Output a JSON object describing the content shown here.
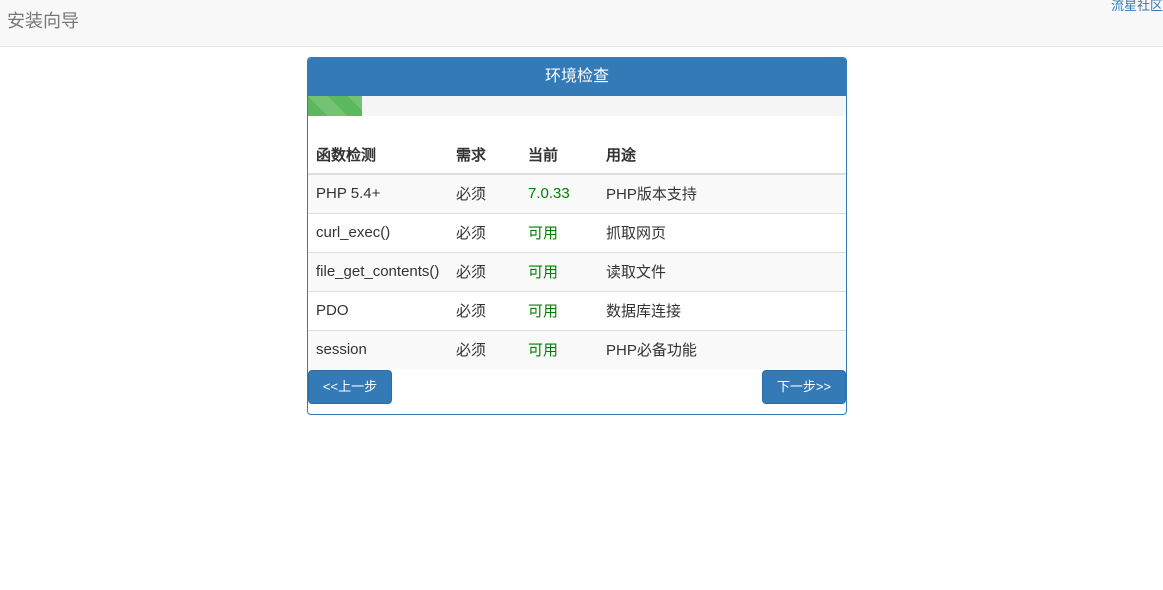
{
  "navbar": {
    "brand": "安装向导",
    "top_link": "流星社区"
  },
  "panel": {
    "title": "环境检查",
    "progress_fraction": 0.1
  },
  "table": {
    "headers": [
      "函数检测",
      "需求",
      "当前",
      "用途"
    ],
    "rows": [
      {
        "name": "PHP 5.4+",
        "require": "必须",
        "current": "7.0.33",
        "purpose": "PHP版本支持"
      },
      {
        "name": "curl_exec()",
        "require": "必须",
        "current": "可用",
        "purpose": "抓取网页"
      },
      {
        "name": "file_get_contents()",
        "require": "必须",
        "current": "可用",
        "purpose": "读取文件"
      },
      {
        "name": "PDO",
        "require": "必须",
        "current": "可用",
        "purpose": "数据库连接"
      },
      {
        "name": "session",
        "require": "必须",
        "current": "可用",
        "purpose": "PHP必备功能"
      }
    ]
  },
  "buttons": {
    "prev_label": "<<上一步",
    "next_label": "下一步>>"
  },
  "colors": {
    "primary": "#337ab7",
    "success": "#5cb85c",
    "ok_text": "#008000"
  }
}
